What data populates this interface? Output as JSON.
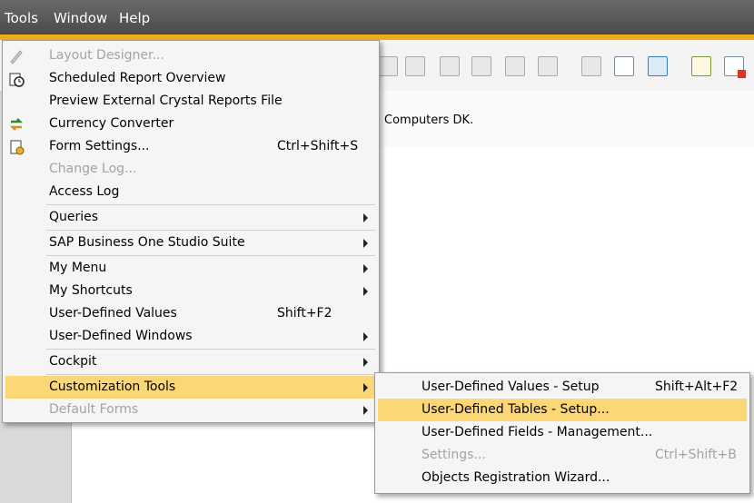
{
  "menubar": {
    "tools": "Tools",
    "window": "Window",
    "help": "Help"
  },
  "content": {
    "company": "Computers DK."
  },
  "tools_menu": {
    "layout_designer": "Layout Designer...",
    "scheduled_report": "Scheduled Report Overview",
    "preview_crystal": "Preview External Crystal Reports File",
    "currency_converter": "Currency Converter",
    "form_settings": "Form Settings...",
    "form_settings_shortcut": "Ctrl+Shift+S",
    "change_log": "Change Log...",
    "access_log": "Access Log",
    "queries": "Queries",
    "studio_suite": "SAP Business One Studio Suite",
    "my_menu": "My Menu",
    "my_shortcuts": "My Shortcuts",
    "udv": "User-Defined Values",
    "udv_shortcut": "Shift+F2",
    "udw": "User-Defined Windows",
    "cockpit": "Cockpit",
    "customization_tools": "Customization Tools",
    "default_forms": "Default Forms"
  },
  "submenu": {
    "udv_setup": "User-Defined Values - Setup",
    "udv_setup_shortcut": "Shift+Alt+F2",
    "udt_setup": "User-Defined Tables - Setup...",
    "udf_mgmt": "User-Defined Fields - Management...",
    "settings": "Settings...",
    "settings_shortcut": "Ctrl+Shift+B",
    "orw": "Objects Registration Wizard..."
  },
  "colors": {
    "highlight": "#fbd775",
    "accent_bar": "#f0ab1d",
    "disabled_text": "#a3a3a3"
  }
}
